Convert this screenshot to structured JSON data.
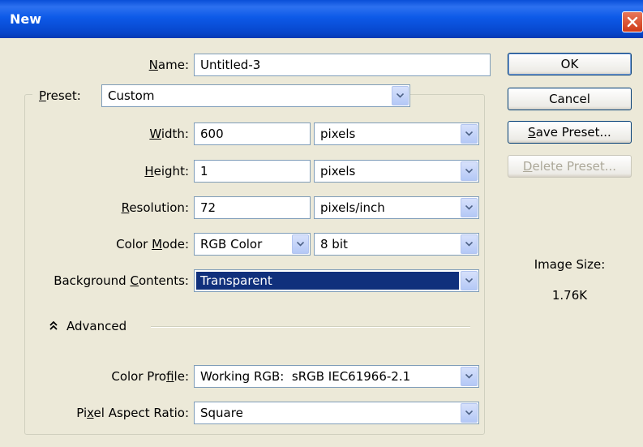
{
  "window": {
    "title": "New"
  },
  "form": {
    "name": {
      "label_pre": "",
      "label_ul": "N",
      "label_post": "ame:",
      "value": "Untitled-3"
    },
    "preset": {
      "label_pre": "",
      "label_ul": "P",
      "label_post": "reset:",
      "value": "Custom"
    },
    "width": {
      "label_pre": "",
      "label_ul": "W",
      "label_post": "idth:",
      "value": "600",
      "unit": "pixels"
    },
    "height": {
      "label_pre": "",
      "label_ul": "H",
      "label_post": "eight:",
      "value": "1",
      "unit": "pixels"
    },
    "resolution": {
      "label_pre": "",
      "label_ul": "R",
      "label_post": "esolution:",
      "value": "72",
      "unit": "pixels/inch"
    },
    "color_mode": {
      "label_pre": "Color ",
      "label_ul": "M",
      "label_post": "ode:",
      "value": "RGB Color",
      "depth": "8 bit"
    },
    "background": {
      "label_pre": "Background ",
      "label_ul": "C",
      "label_post": "ontents:",
      "value": "Transparent"
    },
    "advanced": {
      "label": "Advanced"
    },
    "color_profile": {
      "label_pre": "Color Pro",
      "label_ul": "f",
      "label_post": "ile:",
      "value": "Working RGB:  sRGB IEC61966-2.1"
    },
    "pixel_aspect": {
      "label_pre": "Pi",
      "label_ul": "x",
      "label_post": "el Aspect Ratio:",
      "value": "Square"
    }
  },
  "buttons": {
    "ok": "OK",
    "cancel": "Cancel",
    "save_preset": {
      "ul": "S",
      "rest": "ave Preset..."
    },
    "delete_preset": {
      "ul": "D",
      "rest": "elete Preset..."
    }
  },
  "image_size": {
    "label": "Image Size:",
    "value": "1.76K"
  },
  "colors": {
    "titlebar": "#0a4fd8",
    "dialog_bg": "#ece9d8",
    "selection": "#10307c",
    "field_border": "#7f9db9"
  }
}
